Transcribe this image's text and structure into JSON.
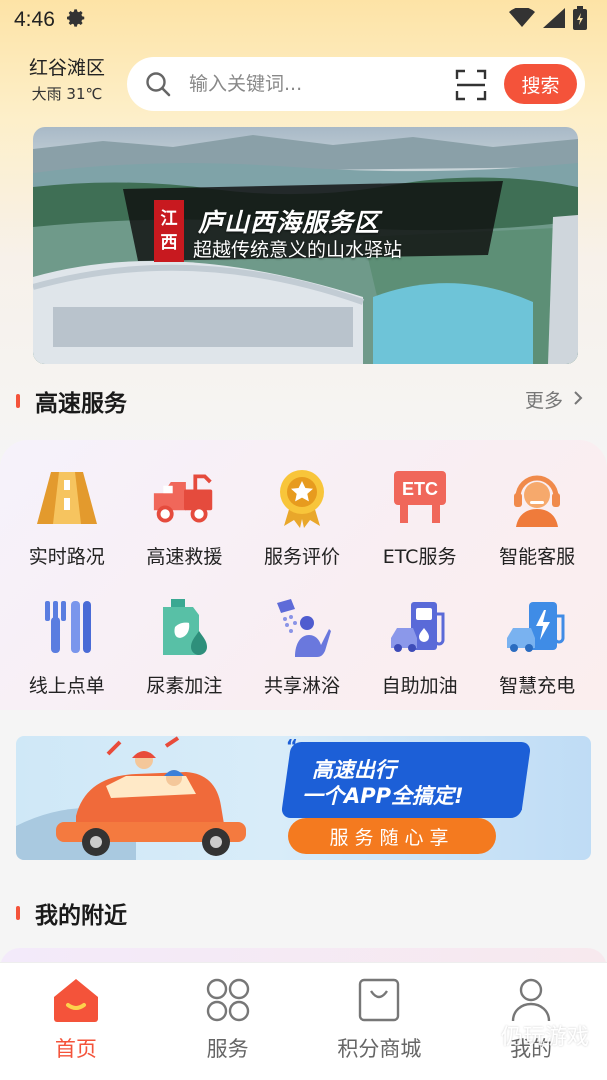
{
  "status_bar": {
    "time": "4:46"
  },
  "header": {
    "location": "红谷滩区",
    "weather": "大雨 31℃",
    "search_placeholder": "输入关键词...",
    "search_button": "搜索"
  },
  "banner": {
    "badge": [
      "江",
      "西"
    ],
    "title": "庐山西海服务区",
    "subtitle": "超越传统意义的山水驿站"
  },
  "services_section": {
    "title": "高速服务",
    "more": "更多",
    "items": [
      {
        "label": "实时路况",
        "icon": "road-icon"
      },
      {
        "label": "高速救援",
        "icon": "tow-truck-icon"
      },
      {
        "label": "服务评价",
        "icon": "medal-icon"
      },
      {
        "label": "ETC服务",
        "icon": "etc-icon"
      },
      {
        "label": "智能客服",
        "icon": "customer-service-icon"
      },
      {
        "label": "线上点单",
        "icon": "cutlery-icon"
      },
      {
        "label": "尿素加注",
        "icon": "urea-icon"
      },
      {
        "label": "共享淋浴",
        "icon": "shower-icon"
      },
      {
        "label": "自助加油",
        "icon": "fuel-pump-icon"
      },
      {
        "label": "智慧充电",
        "icon": "ev-charger-icon"
      }
    ]
  },
  "promo": {
    "line1": "高速出行",
    "line2": "一个APP全搞定!",
    "pill": "服务随心享"
  },
  "nearby_section": {
    "title": "我的附近"
  },
  "bottom_nav": [
    {
      "label": "首页",
      "icon": "home-icon",
      "active": true
    },
    {
      "label": "服务",
      "icon": "grid-icon",
      "active": false
    },
    {
      "label": "积分商城",
      "icon": "shopping-bag-icon",
      "active": false
    },
    {
      "label": "我的",
      "icon": "user-icon",
      "active": false
    }
  ],
  "watermark": "仍玩游戏",
  "colors": {
    "accent": "#f4533a",
    "promo_blue": "#1c5fd7",
    "promo_orange": "#f47a1f"
  }
}
